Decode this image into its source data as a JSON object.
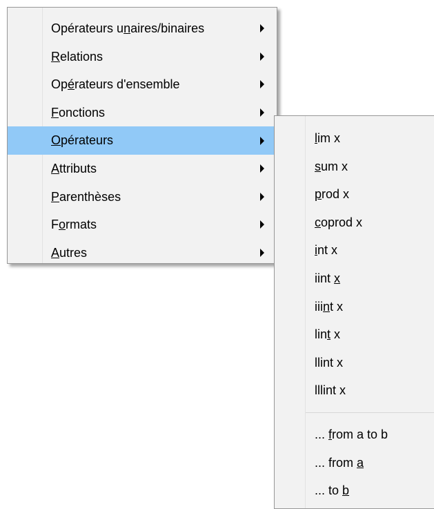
{
  "main_menu": {
    "items": [
      {
        "pre": "Opérateurs u",
        "acc": "n",
        "post": "aires/binaires"
      },
      {
        "pre": "",
        "acc": "R",
        "post": "elations"
      },
      {
        "pre": "Op",
        "acc": "é",
        "post": "rateurs d'ensemble"
      },
      {
        "pre": "",
        "acc": "F",
        "post": "onctions"
      },
      {
        "pre": "",
        "acc": "O",
        "post": "pérateurs"
      },
      {
        "pre": "",
        "acc": "A",
        "post": "ttributs"
      },
      {
        "pre": "",
        "acc": "P",
        "post": "arenthèses"
      },
      {
        "pre": "F",
        "acc": "o",
        "post": "rmats"
      },
      {
        "pre": "",
        "acc": "A",
        "post": "utres"
      }
    ]
  },
  "sub_menu": {
    "items": [
      {
        "pre": "",
        "acc": "l",
        "post": "im x"
      },
      {
        "pre": "",
        "acc": "s",
        "post": "um x"
      },
      {
        "pre": "",
        "acc": "p",
        "post": "rod x"
      },
      {
        "pre": "",
        "acc": "c",
        "post": "oprod x"
      },
      {
        "pre": "",
        "acc": "i",
        "post": "nt x"
      },
      {
        "pre": "iint ",
        "acc": "x",
        "post": ""
      },
      {
        "pre": "iii",
        "acc": "n",
        "post": "t x"
      },
      {
        "pre": "lin",
        "acc": "t",
        "post": " x"
      },
      {
        "pre": "llint x",
        "acc": "",
        "post": ""
      },
      {
        "pre": "lllint x",
        "acc": "",
        "post": ""
      }
    ],
    "extra_items": [
      {
        "pre": "... ",
        "acc": "f",
        "post": "rom a to b"
      },
      {
        "pre": "... from ",
        "acc": "a",
        "post": ""
      },
      {
        "pre": "... to ",
        "acc": "b",
        "post": ""
      }
    ]
  },
  "colors": {
    "highlight": "#91c9f7",
    "menu_bg": "#f2f2f2",
    "border": "#979797"
  }
}
